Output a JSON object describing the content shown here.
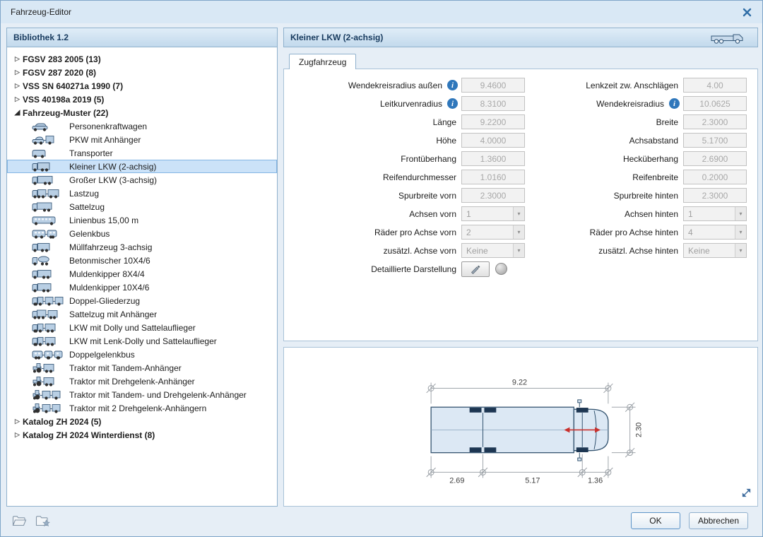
{
  "window": {
    "title": "Fahrzeug-Editor"
  },
  "icons": {
    "info": "i",
    "dropdown": "▾",
    "collapsed_arrow": "▷",
    "expanded_arrow": "◢"
  },
  "colors": {
    "accent_blue": "#2f77bb",
    "selection": "#cbe2f8",
    "header_text": "#173a5e",
    "drawing_red": "#c9302c"
  },
  "library": {
    "header": "Bibliothek 1.2",
    "tree": [
      {
        "label": "FGSV 283 2005 (13)",
        "expanded": false
      },
      {
        "label": "FGSV 287 2020 (8)",
        "expanded": false
      },
      {
        "label": "VSS SN 640271a 1990 (7)",
        "expanded": false
      },
      {
        "label": "VSS 40198a 2019 (5)",
        "expanded": false
      },
      {
        "label": "Fahrzeug-Muster (22)",
        "expanded": true,
        "children": [
          {
            "label": "Personenkraftwagen",
            "icon": "car-icon"
          },
          {
            "label": "PKW mit Anhänger",
            "icon": "car-trailer-icon"
          },
          {
            "label": "Transporter",
            "icon": "van-icon"
          },
          {
            "label": "Kleiner LKW (2-achsig)",
            "icon": "small-truck-icon",
            "selected": true
          },
          {
            "label": "Großer LKW (3-achsig)",
            "icon": "large-truck-icon"
          },
          {
            "label": "Lastzug",
            "icon": "truck-trailer-icon"
          },
          {
            "label": "Sattelzug",
            "icon": "semi-truck-icon"
          },
          {
            "label": "Linienbus 15,00 m",
            "icon": "bus-icon"
          },
          {
            "label": "Gelenkbus",
            "icon": "articulated-bus-icon"
          },
          {
            "label": "Müllfahrzeug 3-achsig",
            "icon": "garbage-truck-icon"
          },
          {
            "label": "Betonmischer 10X4/6",
            "icon": "concrete-mixer-icon"
          },
          {
            "label": "Muldenkipper 8X4/4",
            "icon": "dump-truck-icon"
          },
          {
            "label": "Muldenkipper 10X4/6",
            "icon": "dump-truck-icon"
          },
          {
            "label": "Doppel-Gliederzug",
            "icon": "double-road-train-icon"
          },
          {
            "label": "Sattelzug mit Anhänger",
            "icon": "semi-with-trailer-icon"
          },
          {
            "label": "LKW mit Dolly und Sattelauflieger",
            "icon": "truck-dolly-icon"
          },
          {
            "label": "LKW mit Lenk-Dolly und Sattelauflieger",
            "icon": "truck-lenk-dolly-icon"
          },
          {
            "label": "Doppelgelenkbus",
            "icon": "double-articulated-bus-icon"
          },
          {
            "label": "Traktor mit Tandem-Anhänger",
            "icon": "tractor-trailer-icon"
          },
          {
            "label": "Traktor mit Drehgelenk-Anhänger",
            "icon": "tractor-trailer-icon"
          },
          {
            "label": "Traktor mit Tandem- und Drehgelenk-Anhänger",
            "icon": "tractor-two-trailer-icon"
          },
          {
            "label": "Traktor mit 2 Drehgelenk-Anhängern",
            "icon": "tractor-two-trailer-icon"
          }
        ]
      },
      {
        "label": "Katalog ZH 2024 (5)",
        "expanded": false
      },
      {
        "label": "Katalog ZH 2024 Winterdienst (8)",
        "expanded": false
      }
    ]
  },
  "vehicle": {
    "header": "Kleiner LKW (2-achsig)",
    "tab": "Zugfahrzeug"
  },
  "form": {
    "left": [
      {
        "label": "Wendekreisradius außen",
        "value": "9.4600",
        "info": true,
        "type": "input"
      },
      {
        "label": "Leitkurvenradius",
        "value": "8.3100",
        "info": true,
        "type": "input"
      },
      {
        "label": "Länge",
        "value": "9.2200",
        "type": "input"
      },
      {
        "label": "Höhe",
        "value": "4.0000",
        "type": "input"
      },
      {
        "label": "Frontüberhang",
        "value": "1.3600",
        "type": "input"
      },
      {
        "label": "Reifendurchmesser",
        "value": "1.0160",
        "type": "input"
      },
      {
        "label": "Spurbreite vorn",
        "value": "2.3000",
        "type": "input"
      },
      {
        "label": "Achsen vorn",
        "value": "1",
        "type": "select"
      },
      {
        "label": "Räder pro Achse vorn",
        "value": "2",
        "type": "select"
      },
      {
        "label": "zusätzl. Achse vorn",
        "value": "Keine",
        "type": "select"
      },
      {
        "label": "Detaillierte Darstellung",
        "type": "detail"
      }
    ],
    "right": [
      {
        "label": "Lenkzeit zw. Anschlägen",
        "value": "4.00",
        "type": "input"
      },
      {
        "label": "Wendekreisradius",
        "value": "10.0625",
        "info": true,
        "type": "input"
      },
      {
        "label": "Breite",
        "value": "2.3000",
        "type": "input"
      },
      {
        "label": "Achsabstand",
        "value": "5.1700",
        "type": "input"
      },
      {
        "label": "Hecküberhang",
        "value": "2.6900",
        "type": "input"
      },
      {
        "label": "Reifenbreite",
        "value": "0.2000",
        "type": "input"
      },
      {
        "label": "Spurbreite hinten",
        "value": "2.3000",
        "type": "input"
      },
      {
        "label": "Achsen hinten",
        "value": "1",
        "type": "select"
      },
      {
        "label": "Räder pro Achse hinten",
        "value": "4",
        "type": "select"
      },
      {
        "label": "zusätzl. Achse hinten",
        "value": "Keine",
        "type": "select"
      }
    ]
  },
  "drawing": {
    "length": "9.22",
    "width": "2.30",
    "rear_overhang": "2.69",
    "wheelbase": "5.17",
    "front_overhang": "1.36"
  },
  "buttons": {
    "ok": "OK",
    "cancel": "Abbrechen"
  }
}
